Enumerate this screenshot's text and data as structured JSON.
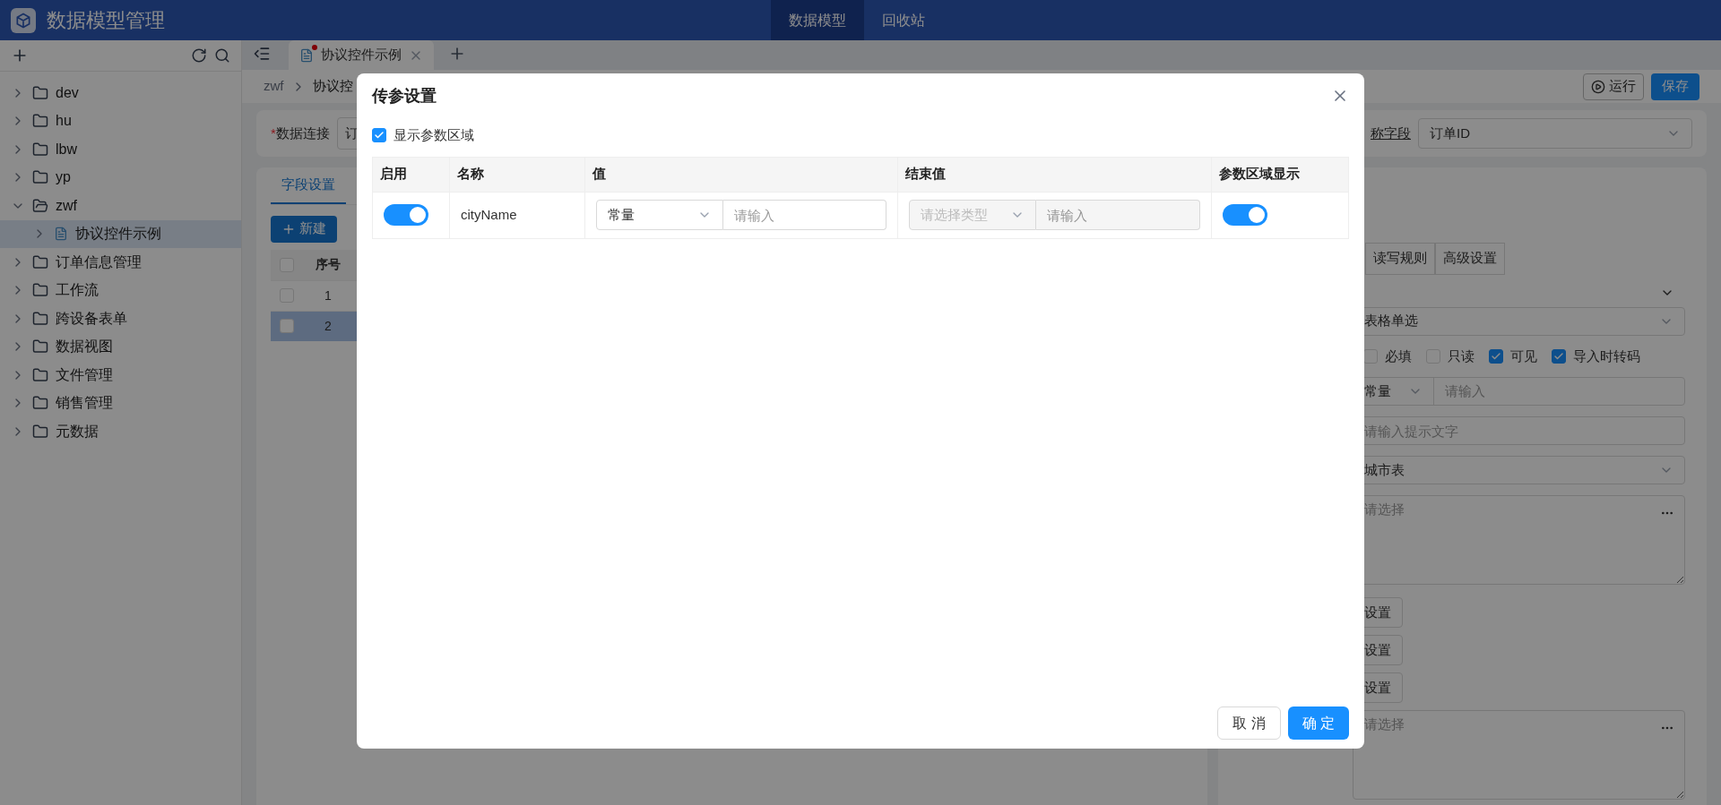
{
  "app": {
    "title": "数据模型管理"
  },
  "nav": [
    {
      "label": "数据模型",
      "selected": true
    },
    {
      "label": "回收站",
      "selected": false
    }
  ],
  "tree": [
    {
      "label": "dev",
      "expanded": false,
      "selected": false
    },
    {
      "label": "hu",
      "expanded": false,
      "selected": false
    },
    {
      "label": "lbw",
      "expanded": false,
      "selected": false
    },
    {
      "label": "yp",
      "expanded": false,
      "selected": false
    },
    {
      "label": "zwf",
      "expanded": true,
      "selected": false,
      "children": [
        {
          "label": "协议控件示例",
          "kind": "model",
          "expanded": false,
          "selected": true
        }
      ]
    },
    {
      "label": "订单信息管理",
      "expanded": false,
      "selected": false
    },
    {
      "label": "工作流",
      "expanded": false,
      "selected": false
    },
    {
      "label": "跨设备表单",
      "expanded": false,
      "selected": false
    },
    {
      "label": "数据视图",
      "expanded": false,
      "selected": false
    },
    {
      "label": "文件管理",
      "expanded": false,
      "selected": false
    },
    {
      "label": "销售管理",
      "expanded": false,
      "selected": false
    },
    {
      "label": "元数据",
      "expanded": false,
      "selected": false
    }
  ],
  "tabs": [
    {
      "label": "协议控件示例",
      "selected": true,
      "modified": true
    }
  ],
  "breadcrumb": [
    "zwf",
    "协议控"
  ],
  "toolbar": {
    "run": "运行",
    "save": "保存"
  },
  "connection": {
    "label": "数据连接",
    "required": true,
    "required_mark": "*",
    "value": "订"
  },
  "name_field": {
    "label": "称字段",
    "value": "订单ID"
  },
  "field_tabs": [
    {
      "label": "字段设置",
      "selected": true
    }
  ],
  "new_button": "新建",
  "field_table": {
    "select_all": false,
    "columns": [
      "序号"
    ],
    "rows": [
      {
        "index": "1",
        "checked": false,
        "selected": false
      },
      {
        "index": "2",
        "checked": false,
        "selected": true
      }
    ]
  },
  "props": {
    "tabs": [
      {
        "label": "读写规则",
        "selected": false
      },
      {
        "label": "高级设置",
        "selected": false
      }
    ],
    "control_type": "表格单选",
    "flags": [
      {
        "label": "必填",
        "checked": false
      },
      {
        "label": "只读",
        "checked": false
      },
      {
        "label": "可见",
        "checked": true
      },
      {
        "label": "导入时转码",
        "checked": true
      }
    ],
    "default": {
      "type": "常量",
      "placeholder": "请输入"
    },
    "hint_placeholder": "请输入提示文字",
    "source": "城市表",
    "filter_placeholder": "请选择",
    "buttons": [
      "设置",
      "设置",
      "设置"
    ],
    "extra_placeholder": "请选择"
  },
  "dialog": {
    "title": "传参设置",
    "show_area": {
      "label": "显示参数区域",
      "checked": true
    },
    "columns": [
      "启用",
      "名称",
      "值",
      "结束值",
      "参数区域显示"
    ],
    "rows": [
      {
        "enabled": true,
        "name": "cityName",
        "value_type": "常量",
        "value_placeholder": "请输入",
        "end_type_placeholder": "请选择类型",
        "end_placeholder": "请输入",
        "end_disabled": true,
        "show_in_area": true
      }
    ],
    "buttons": [
      {
        "label": "取 消",
        "kind": "default"
      },
      {
        "label": "确 定",
        "kind": "primary"
      }
    ]
  }
}
